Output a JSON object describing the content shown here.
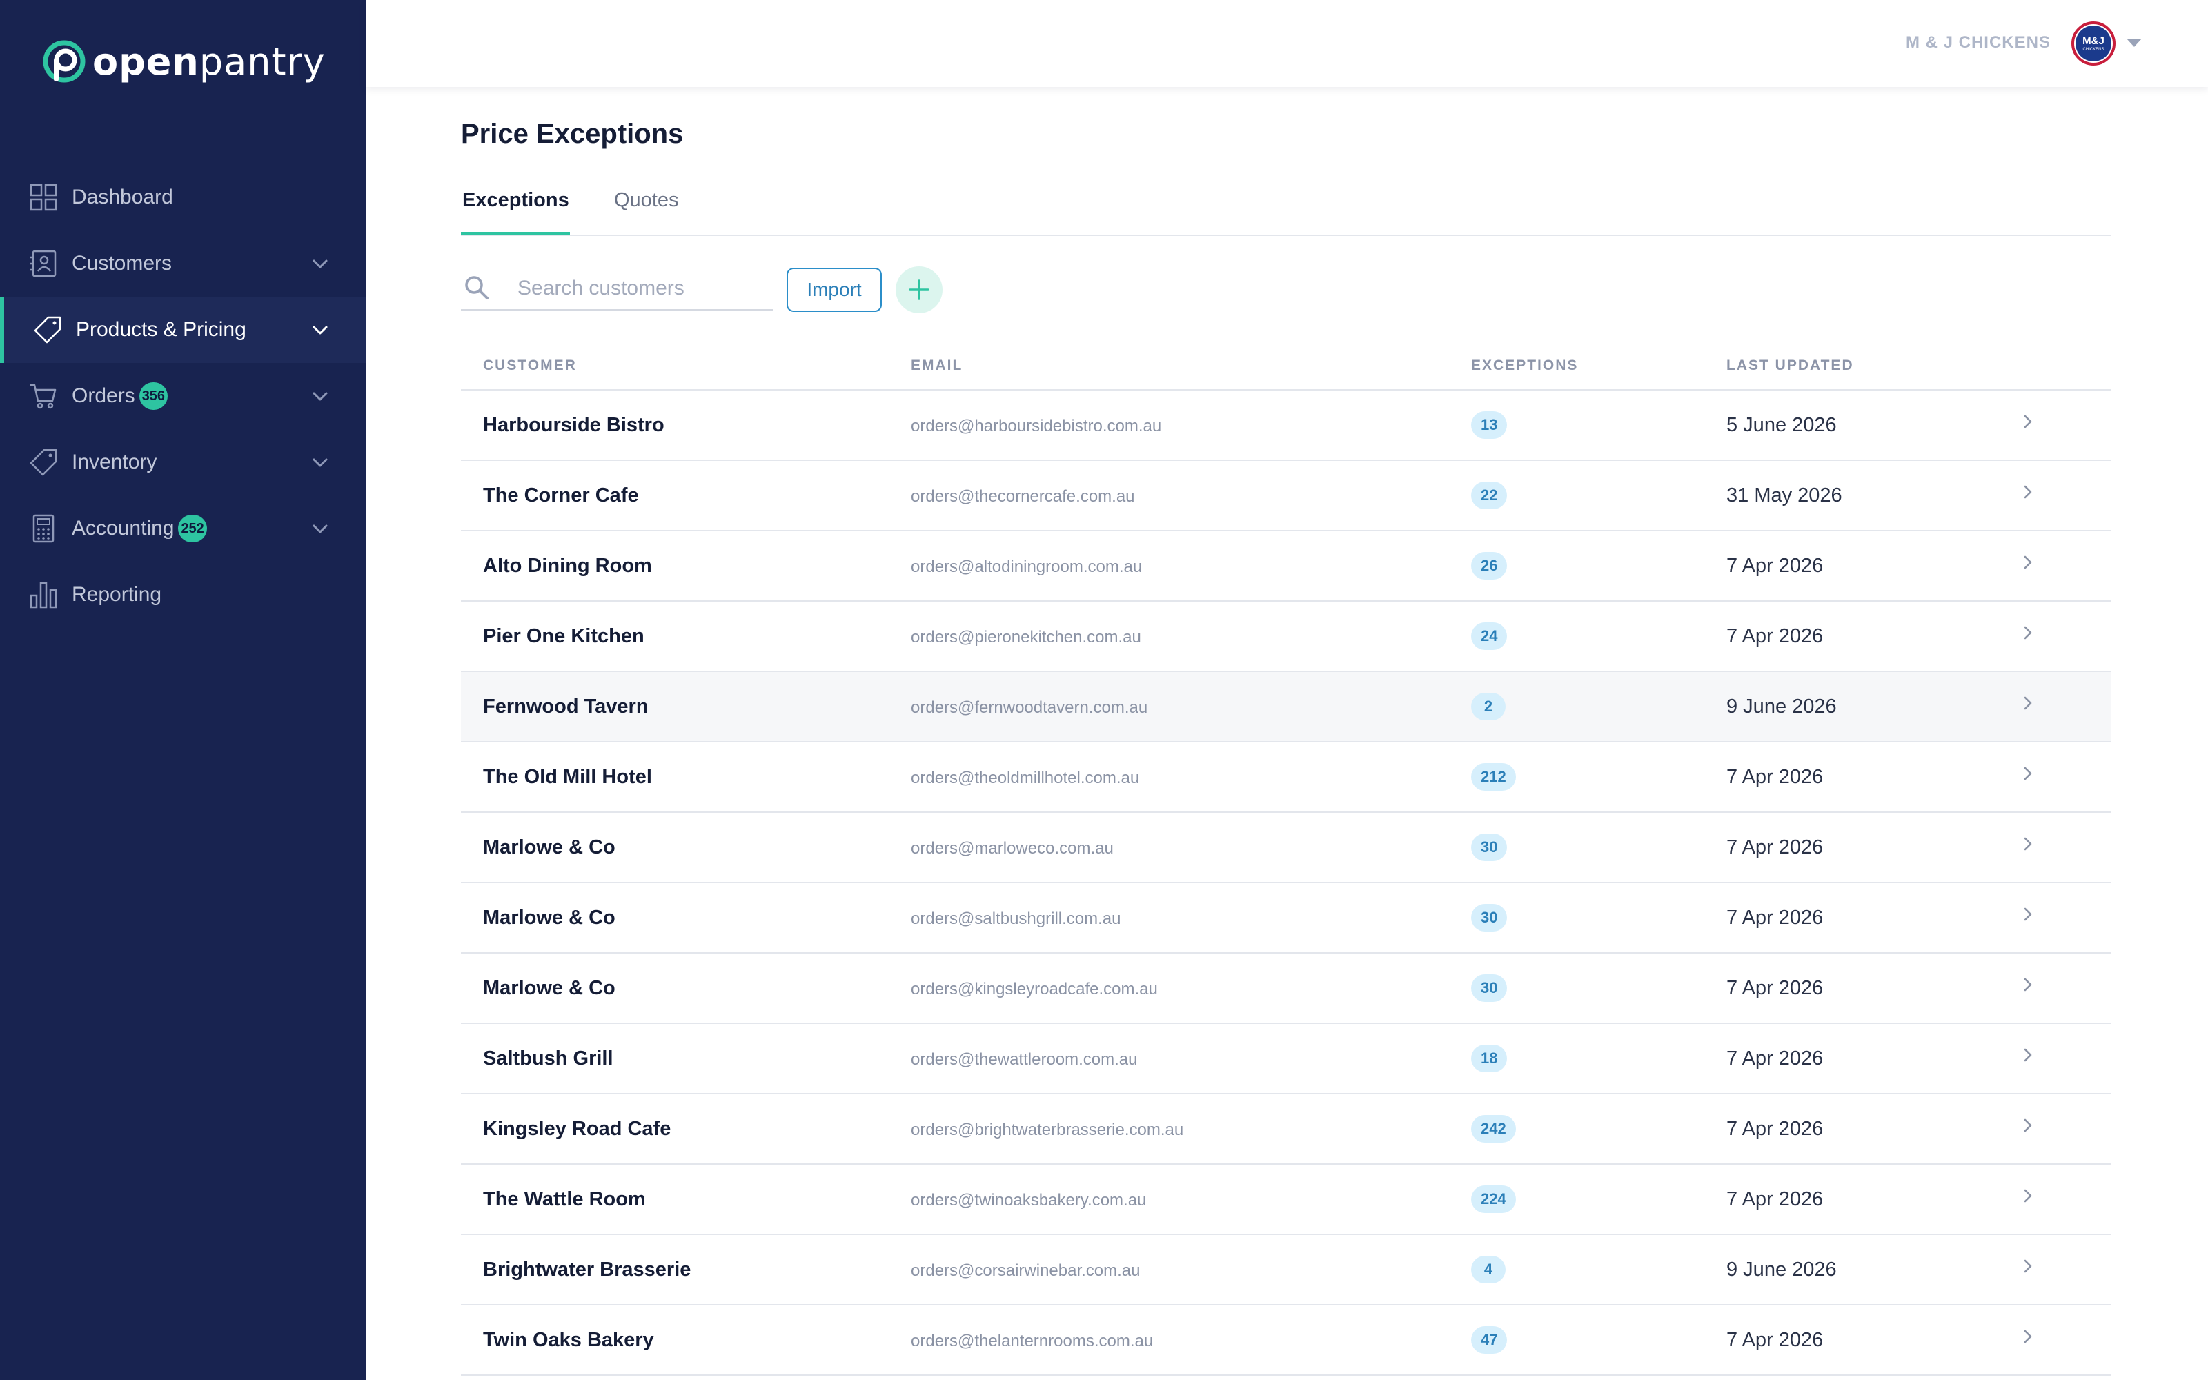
{
  "brand": {
    "logo_bold": "open",
    "logo_light": "pantry"
  },
  "sidebar": {
    "items": [
      {
        "label": "Dashboard",
        "icon": "dashboard-grid-icon",
        "badge": "",
        "chevron": false,
        "active": false
      },
      {
        "label": "Customers",
        "icon": "contacts-book-icon",
        "badge": "",
        "chevron": true,
        "active": false
      },
      {
        "label": "Products & Pricing",
        "icon": "price-tag-icon",
        "badge": "",
        "chevron": true,
        "active": true
      },
      {
        "label": "Orders",
        "icon": "shopping-cart-icon",
        "badge": "356",
        "chevron": true,
        "active": false
      },
      {
        "label": "Inventory",
        "icon": "tag-icon",
        "badge": "",
        "chevron": true,
        "active": false
      },
      {
        "label": "Accounting",
        "icon": "calculator-icon",
        "badge": "252",
        "chevron": true,
        "active": false
      },
      {
        "label": "Reporting",
        "icon": "bar-chart-icon",
        "badge": "",
        "chevron": false,
        "active": false
      }
    ]
  },
  "header": {
    "account_name": "M & J CHICKENS",
    "avatar_text": "M&J",
    "avatar_subtext": "CHICKENS"
  },
  "page": {
    "title": "Price Exceptions",
    "tabs": [
      {
        "label": "Exceptions",
        "active": true
      },
      {
        "label": "Quotes",
        "active": false
      }
    ],
    "search": {
      "placeholder": "Search customers",
      "value": ""
    },
    "import_label": "Import"
  },
  "table": {
    "columns": [
      "CUSTOMER",
      "EMAIL",
      "EXCEPTIONS",
      "LAST UPDATED"
    ],
    "rows": [
      {
        "customer": "Harbourside Bistro",
        "email": "orders@harboursidebistro.com.au",
        "exceptions": "13",
        "updated": "5 June 2026"
      },
      {
        "customer": "The Corner Cafe",
        "email": "orders@thecornercafe.com.au",
        "exceptions": "22",
        "updated": "31 May 2026"
      },
      {
        "customer": "Alto Dining Room",
        "email": "orders@altodiningroom.com.au",
        "exceptions": "26",
        "updated": "7 Apr 2026"
      },
      {
        "customer": "Pier One Kitchen",
        "email": "orders@pieronekitchen.com.au",
        "exceptions": "24",
        "updated": "7 Apr 2026"
      },
      {
        "customer": "Fernwood Tavern",
        "email": "orders@fernwoodtavern.com.au",
        "exceptions": "2",
        "updated": "9 June 2026"
      },
      {
        "customer": "The Old Mill Hotel",
        "email": "orders@theoldmillhotel.com.au",
        "exceptions": "212",
        "updated": "7 Apr 2026"
      },
      {
        "customer": "Marlowe & Co",
        "email": "orders@marloweco.com.au",
        "exceptions": "30",
        "updated": "7 Apr 2026"
      },
      {
        "customer": "Marlowe & Co",
        "email": "orders@saltbushgrill.com.au",
        "exceptions": "30",
        "updated": "7 Apr 2026"
      },
      {
        "customer": "Marlowe & Co",
        "email": "orders@kingsleyroadcafe.com.au",
        "exceptions": "30",
        "updated": "7 Apr 2026"
      },
      {
        "customer": "Saltbush Grill",
        "email": "orders@thewattleroom.com.au",
        "exceptions": "18",
        "updated": "7 Apr 2026"
      },
      {
        "customer": "Kingsley Road Cafe",
        "email": "orders@brightwaterbrasserie.com.au",
        "exceptions": "242",
        "updated": "7 Apr 2026"
      },
      {
        "customer": "The Wattle Room",
        "email": "orders@twinoaksbakery.com.au",
        "exceptions": "224",
        "updated": "7 Apr 2026"
      },
      {
        "customer": "Brightwater Brasserie",
        "email": "orders@corsairwinebar.com.au",
        "exceptions": "4",
        "updated": "9 June 2026"
      },
      {
        "customer": "Twin Oaks Bakery",
        "email": "orders@thelanternrooms.com.au",
        "exceptions": "47",
        "updated": "7 Apr 2026"
      }
    ]
  },
  "colors": {
    "sidebar_bg": "#182350",
    "accent_green": "#2ec4a1",
    "link_blue": "#2b7fb8",
    "badge_bg": "#d6effc"
  }
}
